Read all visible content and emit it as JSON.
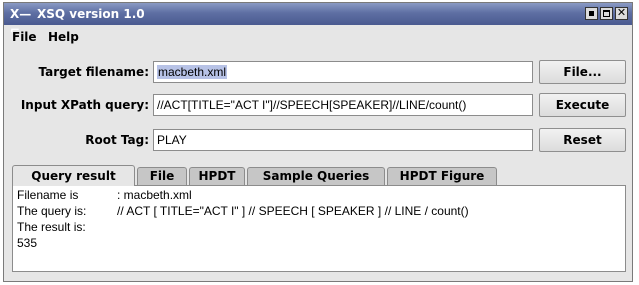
{
  "window": {
    "app_icon_text": "X—⌐",
    "title": "XSQ version 1.0",
    "controls": [
      "minimize",
      "maximize",
      "close"
    ]
  },
  "menu": {
    "file": "File",
    "help": "Help"
  },
  "form": {
    "target_label": "Target filename:",
    "target_value": "macbeth.xml",
    "xpath_label": "Input XPath query:",
    "xpath_value": "//ACT[TITLE=\"ACT I\"]//SPEECH[SPEAKER]//LINE/count()",
    "root_label": "Root Tag:",
    "root_value": "PLAY"
  },
  "buttons": {
    "file": "File...",
    "execute": "Execute",
    "reset": "Reset"
  },
  "tabs": [
    "Query result",
    "File",
    "HPDT",
    "Sample Queries",
    "HPDT Figure"
  ],
  "result": {
    "filename_label": "Filename is",
    "filename_value": ": macbeth.xml",
    "query_label": "The query is:",
    "query_value": "// ACT [ TITLE=\"ACT I\" ] // SPEECH [ SPEAKER ] // LINE / count()",
    "result_label": "The result is:",
    "result_value": "535"
  }
}
